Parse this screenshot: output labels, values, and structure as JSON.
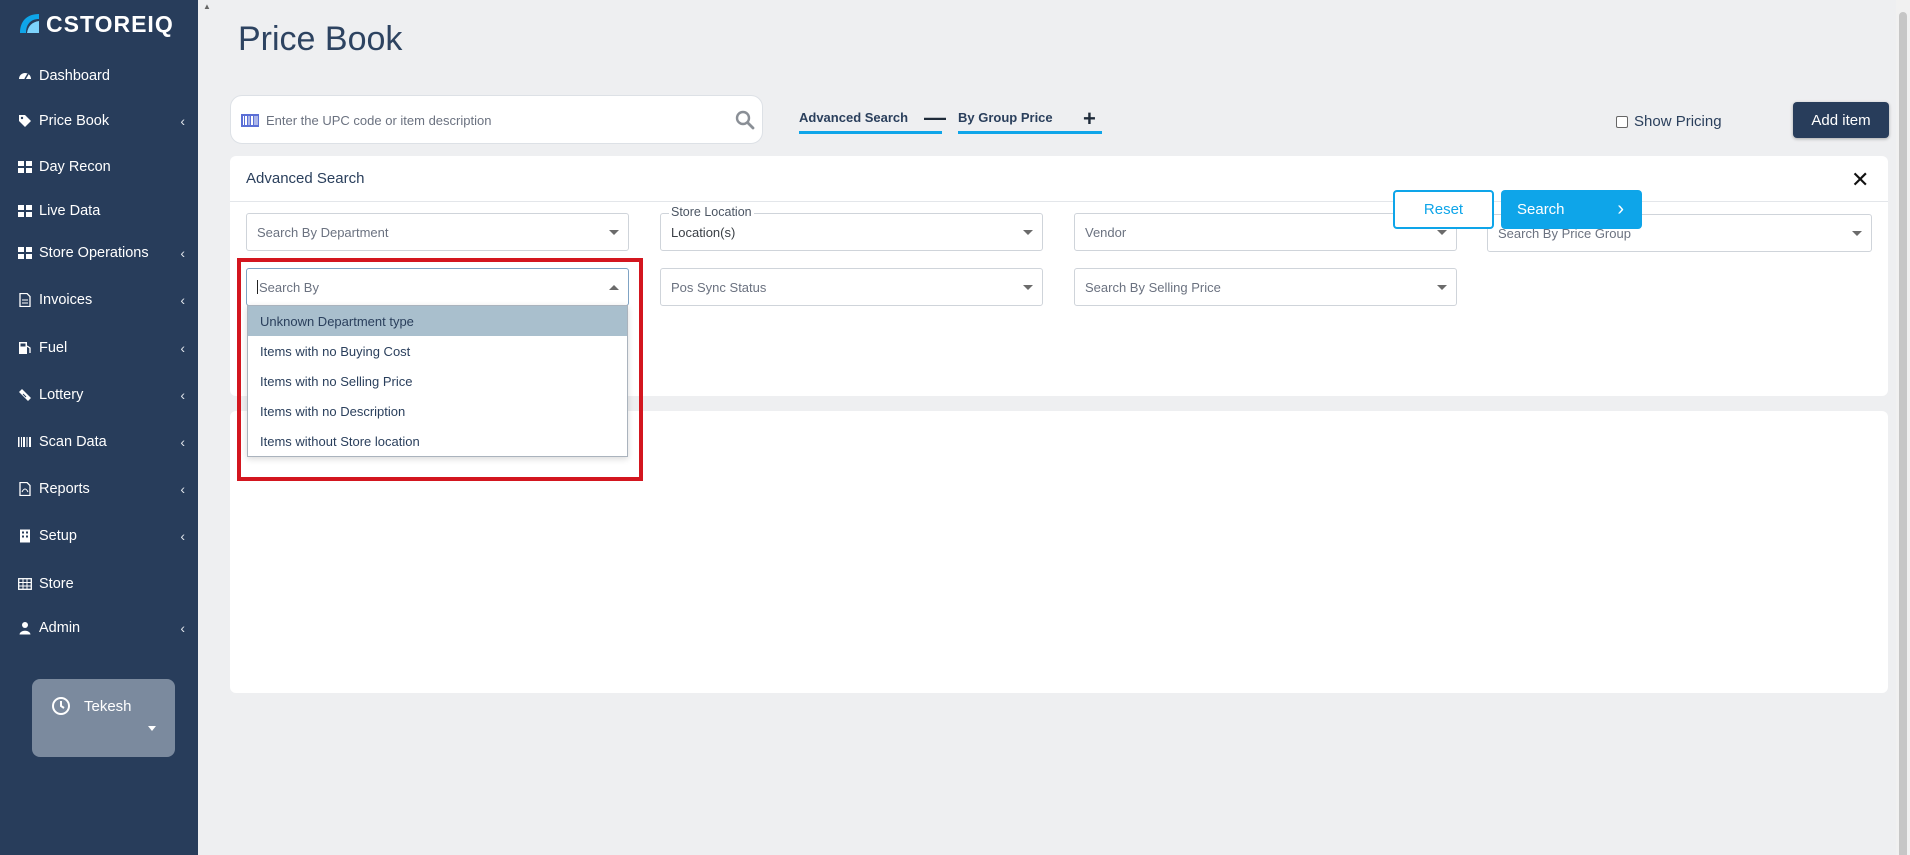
{
  "brand": {
    "name": "CSTOREIQ"
  },
  "sidebar": {
    "items": [
      {
        "label": "Dashboard",
        "icon": "dashboard-icon",
        "has_submenu": false
      },
      {
        "label": "Price Book",
        "icon": "tag-icon",
        "has_submenu": true
      },
      {
        "label": "Day Recon",
        "icon": "grid-icon",
        "has_submenu": false
      },
      {
        "label": "Live Data",
        "icon": "grid-icon",
        "has_submenu": false
      },
      {
        "label": "Store Operations",
        "icon": "grid-icon",
        "has_submenu": true
      },
      {
        "label": "Invoices",
        "icon": "file-icon",
        "has_submenu": true
      },
      {
        "label": "Fuel",
        "icon": "fuel-icon",
        "has_submenu": true
      },
      {
        "label": "Lottery",
        "icon": "ticket-icon",
        "has_submenu": true
      },
      {
        "label": "Scan Data",
        "icon": "barcode-icon",
        "has_submenu": true
      },
      {
        "label": "Reports",
        "icon": "pdf-icon",
        "has_submenu": true
      },
      {
        "label": "Setup",
        "icon": "building-icon",
        "has_submenu": true
      },
      {
        "label": "Store",
        "icon": "table-icon",
        "has_submenu": false
      },
      {
        "label": "Admin",
        "icon": "user-icon",
        "has_submenu": true
      }
    ],
    "user": {
      "name": "Tekesh"
    }
  },
  "page": {
    "title": "Price Book"
  },
  "toolbar": {
    "search_placeholder": "Enter the UPC code or item description",
    "advanced_search_label": "Advanced Search",
    "advanced_search_sign": "—",
    "group_price_label": "By Group Price",
    "group_price_sign": "+",
    "show_pricing_label": "Show Pricing",
    "show_pricing_checked": false,
    "add_item_label": "Add item"
  },
  "advanced_search": {
    "title": "Advanced Search",
    "close_glyph": "✕",
    "department_placeholder": "Search By Department",
    "store_location_label": "Store Location",
    "store_location_value": "Location(s)",
    "vendor_value": "Vendor",
    "price_group_placeholder": "Search By Price Group",
    "search_by_placeholder": "Search By",
    "pos_sync_placeholder": "Pos Sync Status",
    "selling_price_placeholder": "Search By Selling Price",
    "reset_label": "Reset",
    "search_label": "Search",
    "search_by_options": [
      "Unknown Department type",
      "Items with no Buying Cost",
      "Items with no Selling Price",
      "Items with no Description",
      "Items without Store location"
    ],
    "active_option_index": 0
  },
  "colors": {
    "sidebar_bg": "#283d5b",
    "accent": "#0ea5e9",
    "highlight_border": "#d3161f",
    "page_bg": "#eeeff1"
  }
}
